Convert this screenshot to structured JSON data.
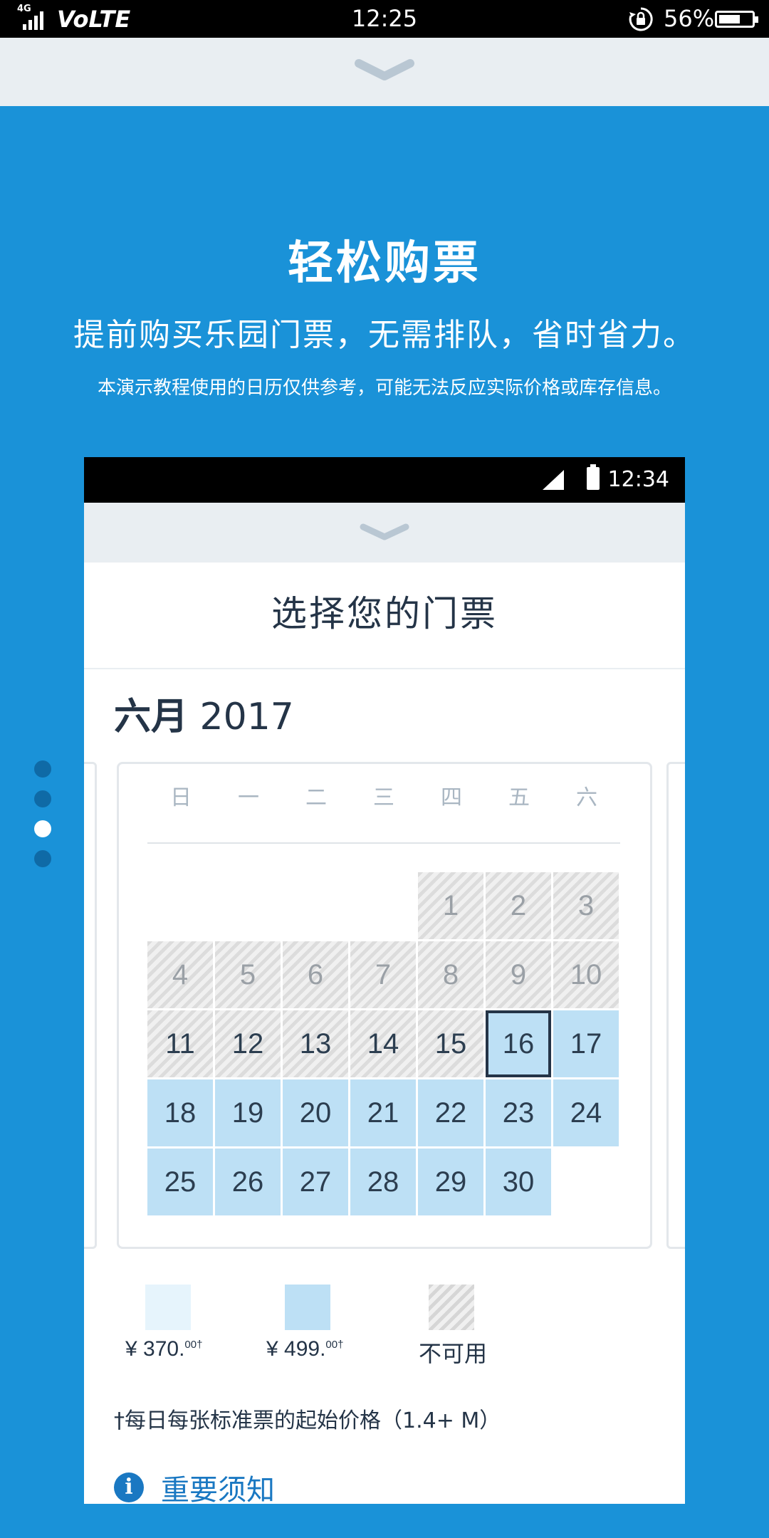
{
  "status_bar": {
    "network": "4G",
    "volte": "VoLTE",
    "time": "12:25",
    "battery": "56%"
  },
  "hero": {
    "title": "轻松购票",
    "subtitle": "提前购买乐园门票，无需排队，省时省力。",
    "note": "本演示教程使用的日历仅供参考，可能无法反应实际价格或库存信息。"
  },
  "pager": {
    "count": 4,
    "active_index": 2
  },
  "phone": {
    "status_time": "12:34",
    "title": "选择您的门票",
    "month": "六月",
    "year": "2017",
    "weekdays": [
      "日",
      "一",
      "二",
      "三",
      "四",
      "五",
      "六"
    ],
    "first_weekday_index": 4,
    "days": [
      {
        "d": "1",
        "s": "na-past"
      },
      {
        "d": "2",
        "s": "na-past"
      },
      {
        "d": "3",
        "s": "na-past"
      },
      {
        "d": "4",
        "s": "na-past"
      },
      {
        "d": "5",
        "s": "na-past"
      },
      {
        "d": "6",
        "s": "na-past"
      },
      {
        "d": "7",
        "s": "na-past"
      },
      {
        "d": "8",
        "s": "na-past"
      },
      {
        "d": "9",
        "s": "na-past"
      },
      {
        "d": "10",
        "s": "na-past"
      },
      {
        "d": "11",
        "s": "na"
      },
      {
        "d": "12",
        "s": "na"
      },
      {
        "d": "13",
        "s": "na"
      },
      {
        "d": "14",
        "s": "na"
      },
      {
        "d": "15",
        "s": "na"
      },
      {
        "d": "16",
        "s": "avail",
        "selected": true
      },
      {
        "d": "17",
        "s": "avail"
      },
      {
        "d": "18",
        "s": "avail"
      },
      {
        "d": "19",
        "s": "avail"
      },
      {
        "d": "20",
        "s": "avail"
      },
      {
        "d": "21",
        "s": "avail"
      },
      {
        "d": "22",
        "s": "avail"
      },
      {
        "d": "23",
        "s": "avail"
      },
      {
        "d": "24",
        "s": "avail"
      },
      {
        "d": "25",
        "s": "avail"
      },
      {
        "d": "26",
        "s": "avail"
      },
      {
        "d": "27",
        "s": "avail"
      },
      {
        "d": "28",
        "s": "avail"
      },
      {
        "d": "29",
        "s": "avail"
      },
      {
        "d": "30",
        "s": "avail"
      }
    ],
    "legend": {
      "low_price": "¥ 370.",
      "low_price_sup": "00†",
      "high_price": "¥ 499.",
      "high_price_sup": "00†",
      "unavailable": "不可用",
      "low_color": "#e6f4fc",
      "high_color": "#bde0f5"
    },
    "footnote": "†每日每张标准票的起始价格（1.4+ M）",
    "notice_label": "重要须知"
  },
  "icons": [
    "signal-icon",
    "rotation-lock-icon",
    "battery-icon",
    "chevron-down-icon",
    "info-icon"
  ]
}
